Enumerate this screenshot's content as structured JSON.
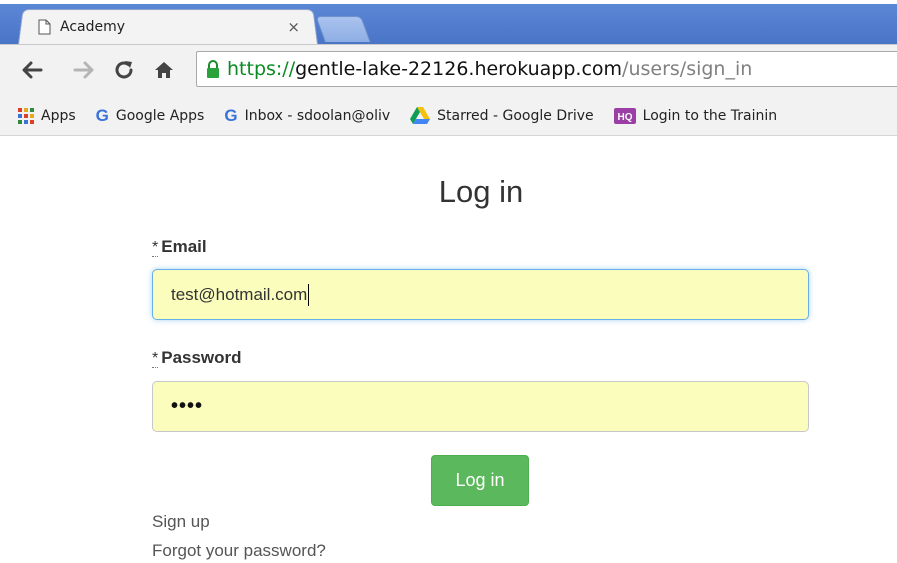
{
  "browser": {
    "tab_title": "Academy",
    "tab_close": "×",
    "url_scheme": "https://",
    "url_host": "gentle-lake-22126.herokuapp.com",
    "url_path": "/users/sign_in",
    "bookmarks": [
      {
        "icon": "apps-grid-icon",
        "label": "Apps"
      },
      {
        "icon": "google-icon",
        "label": "Google Apps"
      },
      {
        "icon": "google-icon",
        "label": "Inbox - sdoolan@oliv"
      },
      {
        "icon": "google-drive-icon",
        "label": "Starred - Google Drive"
      },
      {
        "icon": "hq-icon",
        "label": "Login to the Trainin"
      }
    ]
  },
  "page": {
    "title": "Log in",
    "email": {
      "required_mark": "*",
      "label": "Email",
      "value": "test@hotmail.com"
    },
    "password": {
      "required_mark": "*",
      "label": "Password",
      "value": "••••"
    },
    "submit_label": "Log in",
    "links": {
      "sign_up": "Sign up",
      "forgot": "Forgot your password?"
    }
  },
  "colors": {
    "tab_strip": "#4a74c6",
    "input_autofill": "#fbfdbd",
    "button_green": "#5cb85c",
    "url_secure_green": "#0a8a22"
  }
}
